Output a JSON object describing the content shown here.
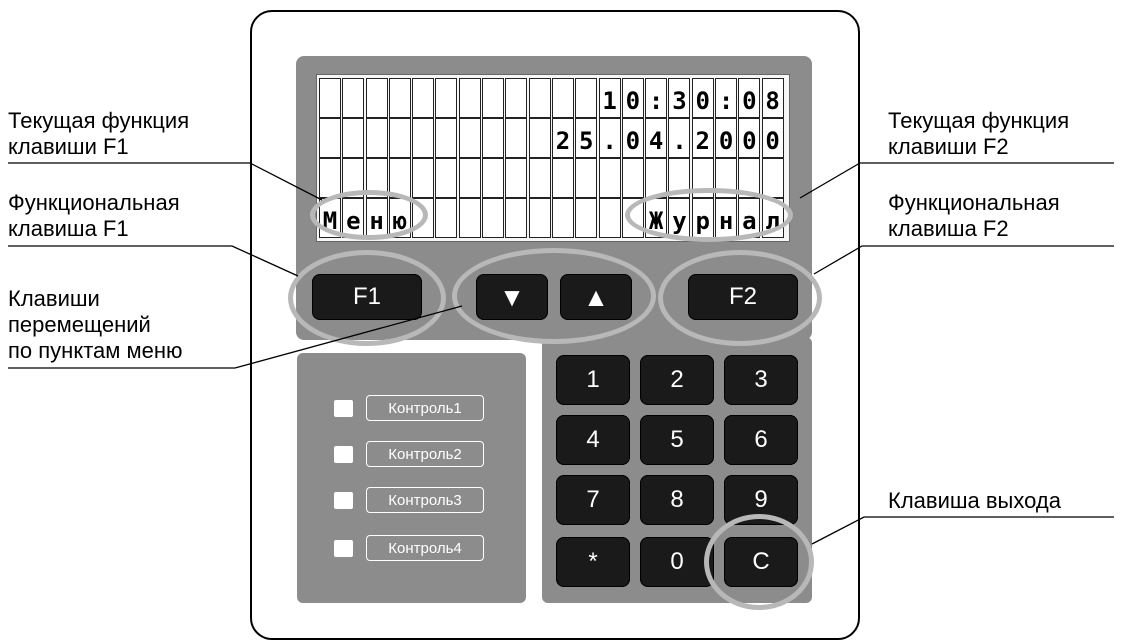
{
  "callouts": {
    "f1_current": [
      "Текущая функция",
      "клавиши F1"
    ],
    "f1_key": [
      "Функциональная",
      "клавиша F1"
    ],
    "nav_keys": [
      "Клавиши",
      "перемещений",
      "по пунктам меню"
    ],
    "f2_current": [
      "Текущая функция",
      "клавиши F2"
    ],
    "f2_key": [
      "Функциональная",
      "клавиша F2"
    ],
    "exit_key": "Клавиша выхода"
  },
  "lcd_rows": [
    "            10:30:08",
    "          25.04.2000",
    "                    ",
    "Меню          Журнал"
  ],
  "keys": {
    "f1": "F1",
    "f2": "F2",
    "down": "▼",
    "up": "▲",
    "keypad": [
      "1",
      "2",
      "3",
      "4",
      "5",
      "6",
      "7",
      "8",
      "9",
      "*",
      "0",
      "C"
    ]
  },
  "controls": [
    "Контроль1",
    "Контроль2",
    "Контроль3",
    "Контроль4"
  ]
}
